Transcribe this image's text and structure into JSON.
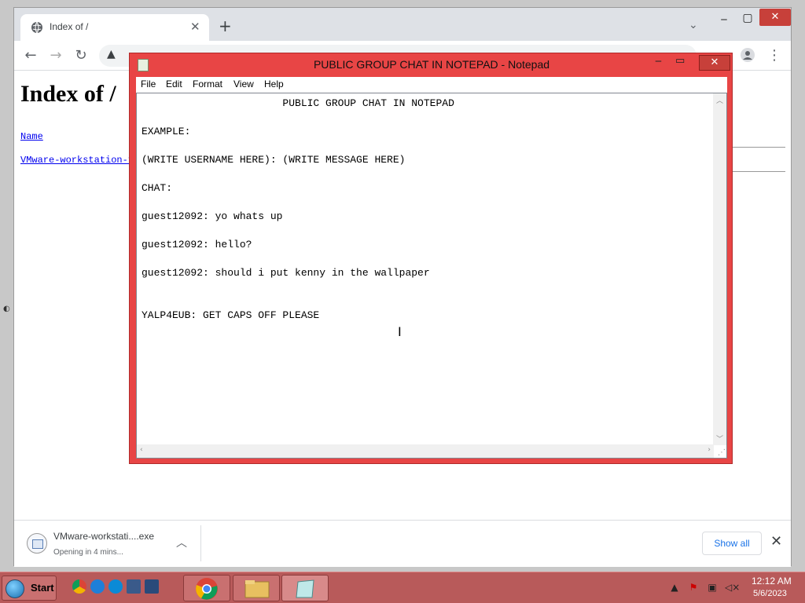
{
  "browser": {
    "tab_title": "Index of /",
    "page_heading": "Index of /",
    "name_column": "Name",
    "file_link": "VMware-workstation-f",
    "download": {
      "file_name": "VMware-workstati....exe",
      "status": "Opening in 4 mins...",
      "show_all": "Show all"
    }
  },
  "notepad": {
    "window_title": "PUBLIC GROUP CHAT IN NOTEPAD - Notepad",
    "menu": [
      "File",
      "Edit",
      "Format",
      "View",
      "Help"
    ],
    "lines": [
      "                       PUBLIC GROUP CHAT IN NOTEPAD",
      "EXAMPLE:",
      "(WRITE USERNAME HERE): (WRITE MESSAGE HERE)",
      "CHAT:",
      "guest12092: yo whats up",
      "guest12092: hello?",
      "guest12092: should i put kenny in the wallpaper",
      "YALP4EUB: GET CAPS OFF PLEASE"
    ]
  },
  "taskbar": {
    "start_label": "Start",
    "time": "12:12 AM",
    "date": "5/6/2023"
  },
  "icons": {
    "globe": "globe-icon",
    "back": "back-arrow-icon",
    "forward": "forward-arrow-icon",
    "reload": "reload-icon",
    "warning": "warning-icon",
    "profile": "profile-icon",
    "menu": "kebab-menu-icon"
  },
  "colors": {
    "notepad_frame": "#e84545",
    "taskbar": "#b85a5a",
    "link": "#0000ee",
    "accent_blue": "#1a73e8"
  }
}
